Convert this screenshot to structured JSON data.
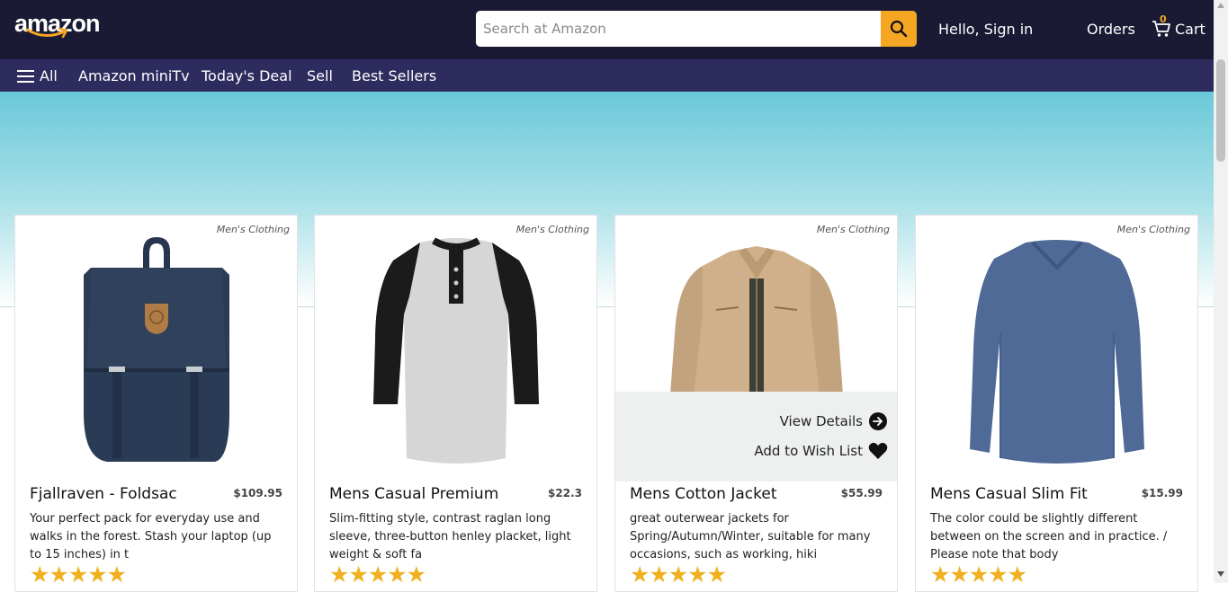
{
  "header": {
    "logo": "amazon",
    "search_placeholder": "Search at Amazon",
    "greeting": "Hello, Sign in",
    "orders": "Orders",
    "cart_label": "Cart",
    "cart_count": "0",
    "colors": {
      "topbar": "#1a1a35",
      "subnav": "#2e2b5f",
      "accent": "#f5a623"
    }
  },
  "subnav": {
    "all": "All",
    "items": [
      "Amazon miniTv",
      "Today's Deal",
      "Sell",
      "Best Sellers"
    ]
  },
  "products": [
    {
      "category": "Men's Clothing",
      "title": "Fjallraven - Foldsac",
      "price": "$109.95",
      "description": "Your perfect pack for everyday use and walks in the forest. Stash your laptop (up to 15 inches) in t",
      "stars": "★★★★★",
      "image": "backpack"
    },
    {
      "category": "Men's Clothing",
      "title": "Mens Casual Premium",
      "price": "$22.3",
      "description": "Slim-fitting style, contrast raglan long sleeve, three-button henley placket, light weight & soft fa",
      "stars": "★★★★★",
      "image": "raglan-shirt"
    },
    {
      "category": "Men's Clothing",
      "title": "Mens Cotton Jacket",
      "price": "$55.99",
      "description": "great outerwear jackets for Spring/Autumn/Winter, suitable for many occasions, such as working, hiki",
      "stars": "★★★★★",
      "image": "jacket",
      "overlay": {
        "view_details": "View Details",
        "add_wishlist": "Add to Wish List"
      }
    },
    {
      "category": "Men's Clothing",
      "title": "Mens Casual Slim Fit",
      "price": "$15.99",
      "description": "The color could be slightly different between on the screen and in practice. / Please note that body",
      "stars": "★★★★★",
      "image": "long-sleeve-tee"
    }
  ]
}
